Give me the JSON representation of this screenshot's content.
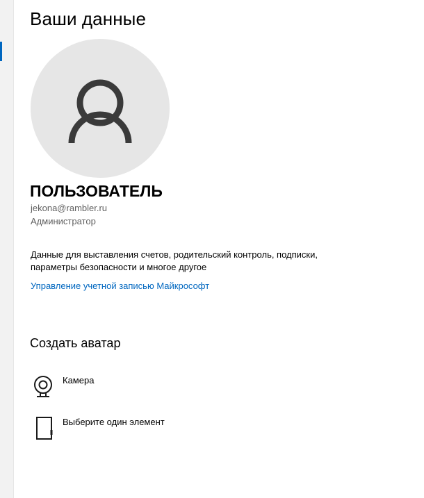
{
  "page": {
    "title": "Ваши данные"
  },
  "user": {
    "name": "ПОЛЬЗОВАТЕЛЬ",
    "email": "jekona@rambler.ru",
    "role": "Администратор",
    "avatar_icon": "person-icon"
  },
  "account": {
    "description": "Данные для выставления счетов, родительский контроль, подписки, параметры безопасности и многое другое",
    "manage_link": "Управление учетной записью Майкрософт"
  },
  "create_avatar": {
    "title": "Создать аватар",
    "options": [
      {
        "label": "Камера",
        "icon": "camera-icon"
      },
      {
        "label": "Выберите один элемент",
        "icon": "file-browse-icon"
      }
    ]
  },
  "colors": {
    "accent": "#0067c0",
    "avatar_bg": "#e6e6e6",
    "icon": "#3a3a3a"
  }
}
